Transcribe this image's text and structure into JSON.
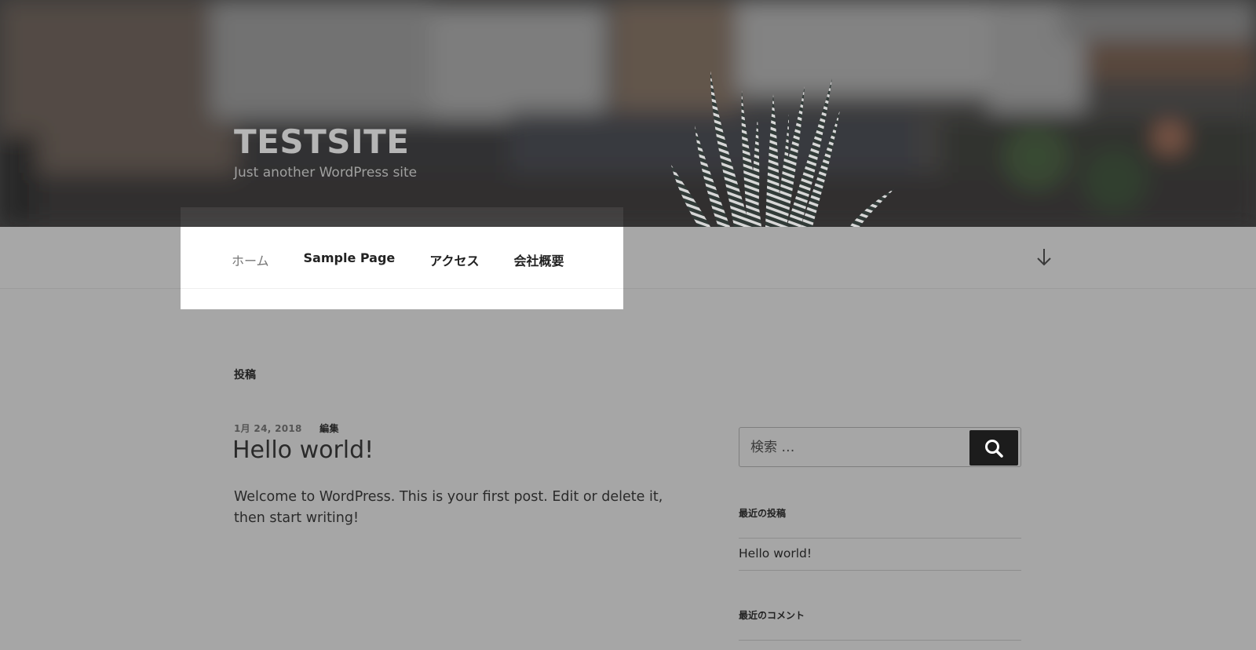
{
  "site": {
    "title": "TESTSITE",
    "description": "Just another WordPress site"
  },
  "nav": {
    "items": [
      {
        "label": "ホーム",
        "current": true
      },
      {
        "label": "Sample Page",
        "current": false
      },
      {
        "label": "アクセス",
        "current": false
      },
      {
        "label": "会社概要",
        "current": false
      }
    ],
    "scroll_icon": "arrow-down-icon"
  },
  "main": {
    "heading": "投稿",
    "post": {
      "date": "1月 24, 2018",
      "edit_label": "編集",
      "title": "Hello world!",
      "excerpt": "Welcome to WordPress. This is your first post. Edit or delete it, then start writing!"
    }
  },
  "sidebar": {
    "search": {
      "placeholder": "検索 …",
      "button_icon": "search-icon"
    },
    "recent_posts": {
      "title": "最近の投稿",
      "items": [
        "Hello world!"
      ]
    },
    "recent_comments": {
      "title": "最近のコメント"
    }
  },
  "colors": {
    "overlay_gray": "#a6a6a6",
    "menu_bg": "#ffffff",
    "search_button_bg": "#1c1c1c"
  }
}
